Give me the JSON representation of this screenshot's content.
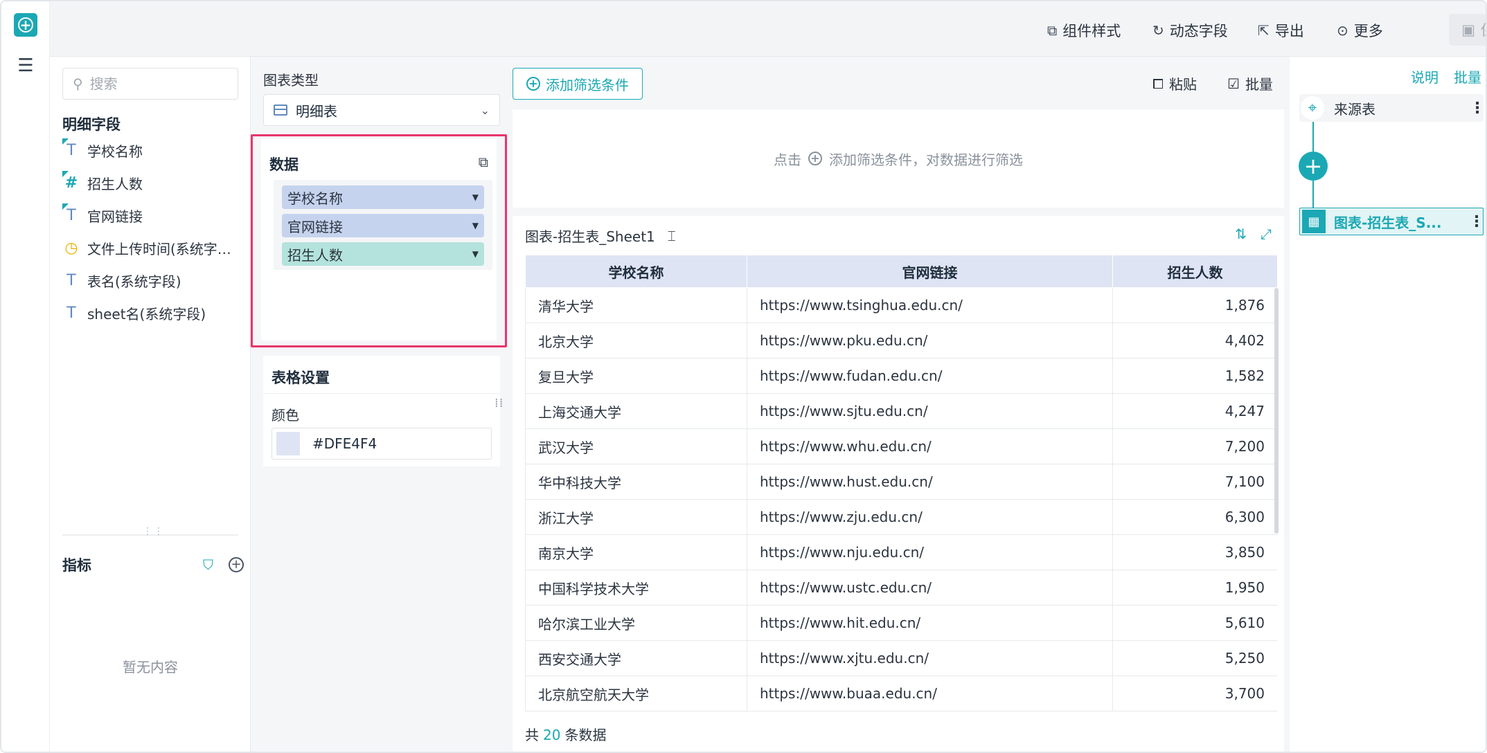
{
  "toolbar": {
    "component_style": "组件样式",
    "dynamic_field": "动态字段",
    "export": "导出",
    "more": "更多",
    "save": "保存"
  },
  "fields_panel": {
    "search_placeholder": "搜索",
    "detail_title": "明细字段",
    "fields": [
      {
        "label": "学校名称",
        "type": "T"
      },
      {
        "label": "招生人数",
        "type": "#"
      },
      {
        "label": "官网链接",
        "type": "T"
      },
      {
        "label": "文件上传时间(系统字…",
        "type": "◷"
      },
      {
        "label": "表名(系统字段)",
        "type": "T"
      },
      {
        "label": "sheet名(系统字段)",
        "type": "T"
      }
    ],
    "metric_title": "指标",
    "empty_text": "暂无内容"
  },
  "config": {
    "chart_type_label": "图表类型",
    "chart_type_value": "明细表",
    "data_title": "数据",
    "data_fields": [
      "学校名称",
      "官网链接",
      "招生人数"
    ],
    "table_settings_title": "表格设置",
    "color_label": "颜色",
    "color_value": "#DFE4F4"
  },
  "main": {
    "add_filter": "添加筛选条件",
    "paste": "粘贴",
    "batch": "批量",
    "filter_hint_prefix": "点击",
    "filter_hint_suffix": "添加筛选条件，对数据进行筛选",
    "chart_title": "图表-招生表_Sheet1",
    "columns": [
      "学校名称",
      "官网链接",
      "招生人数"
    ],
    "rows": [
      [
        "清华大学",
        "https://www.tsinghua.edu.cn/",
        "1,876"
      ],
      [
        "北京大学",
        "https://www.pku.edu.cn/",
        "4,402"
      ],
      [
        "复旦大学",
        "https://www.fudan.edu.cn/",
        "1,582"
      ],
      [
        "上海交通大学",
        "https://www.sjtu.edu.cn/",
        "4,247"
      ],
      [
        "武汉大学",
        "https://www.whu.edu.cn/",
        "7,200"
      ],
      [
        "华中科技大学",
        "https://www.hust.edu.cn/",
        "7,100"
      ],
      [
        "浙江大学",
        "https://www.zju.edu.cn/",
        "6,300"
      ],
      [
        "南京大学",
        "https://www.nju.edu.cn/",
        "3,850"
      ],
      [
        "中国科学技术大学",
        "https://www.ustc.edu.cn/",
        "1,950"
      ],
      [
        "哈尔滨工业大学",
        "https://www.hit.edu.cn/",
        "5,610"
      ],
      [
        "西安交通大学",
        "https://www.xjtu.edu.cn/",
        "5,250"
      ],
      [
        "北京航空航天大学",
        "https://www.buaa.edu.cn/",
        "3,700"
      ]
    ],
    "total_prefix": "共",
    "total_count": "20",
    "total_suffix": "条数据"
  },
  "flow": {
    "explain": "说明",
    "batch": "批量",
    "source_node": "来源表",
    "chart_node": "图表-招生表_S..."
  },
  "colors": {
    "accent": "#1ba8b4",
    "highlight_border": "#e8356b",
    "header_bg": "#DFE4F4"
  }
}
